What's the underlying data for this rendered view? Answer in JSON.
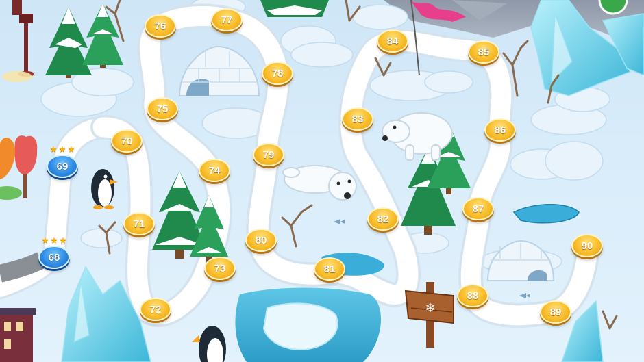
{
  "level_map": {
    "completed_levels": [
      {
        "label": "68",
        "stars": 3
      },
      {
        "label": "69",
        "stars": 3
      }
    ],
    "levels": [
      "70",
      "71",
      "72",
      "73",
      "74",
      "75",
      "76",
      "77",
      "78",
      "79",
      "80",
      "81",
      "82",
      "83",
      "84",
      "85",
      "86",
      "87",
      "88",
      "89",
      "90"
    ]
  },
  "icons": {
    "star": "★",
    "signpost": "snowflake-signpost-icon"
  },
  "colors": {
    "level_node": "#f8bd2a",
    "completed_node": "#2b88e0",
    "star": "#ffb400",
    "water": "#3aaed8",
    "ice": "#7fd7ee",
    "snow": "#ffffff"
  }
}
